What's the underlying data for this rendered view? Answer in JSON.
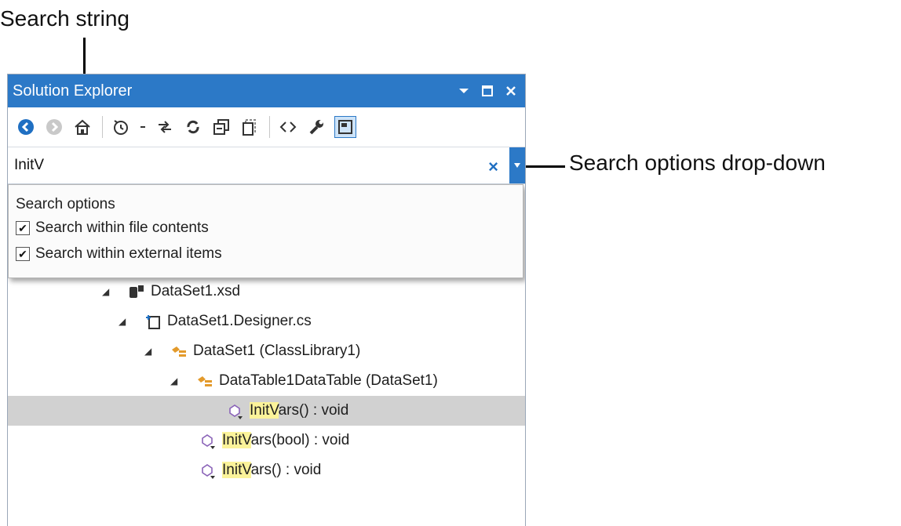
{
  "callouts": {
    "search_string": "Search string",
    "search_options": "Search options drop-down"
  },
  "window": {
    "title": "Solution Explorer"
  },
  "search": {
    "value": "InitV"
  },
  "options": {
    "header": "Search options",
    "items": [
      {
        "label": "Search within file contents",
        "checked": true
      },
      {
        "label": "Search within external items",
        "checked": true
      }
    ]
  },
  "tree": {
    "nodes": [
      {
        "label": "DataSet1.xsd",
        "icon": "xsd-file-icon",
        "expanded": true
      },
      {
        "label": "DataSet1.Designer.cs",
        "icon": "cs-file-icon",
        "expanded": true
      },
      {
        "label": "DataSet1  (ClassLibrary1)",
        "icon": "class-icon",
        "expanded": true
      },
      {
        "label": "DataTable1DataTable  (DataSet1)",
        "icon": "class-icon",
        "expanded": true
      },
      {
        "label_hl": "InitV",
        "label_rest": "ars() : void",
        "icon": "method-icon",
        "selected": true
      },
      {
        "label_hl": "InitV",
        "label_rest": "ars(bool) : void",
        "icon": "method-icon"
      },
      {
        "label_hl": "InitV",
        "label_rest": "ars() : void",
        "icon": "method-icon"
      }
    ]
  },
  "colors": {
    "titlebar": "#2c79c7",
    "selection": "#d1d1d1",
    "highlight": "#fbf39a"
  }
}
